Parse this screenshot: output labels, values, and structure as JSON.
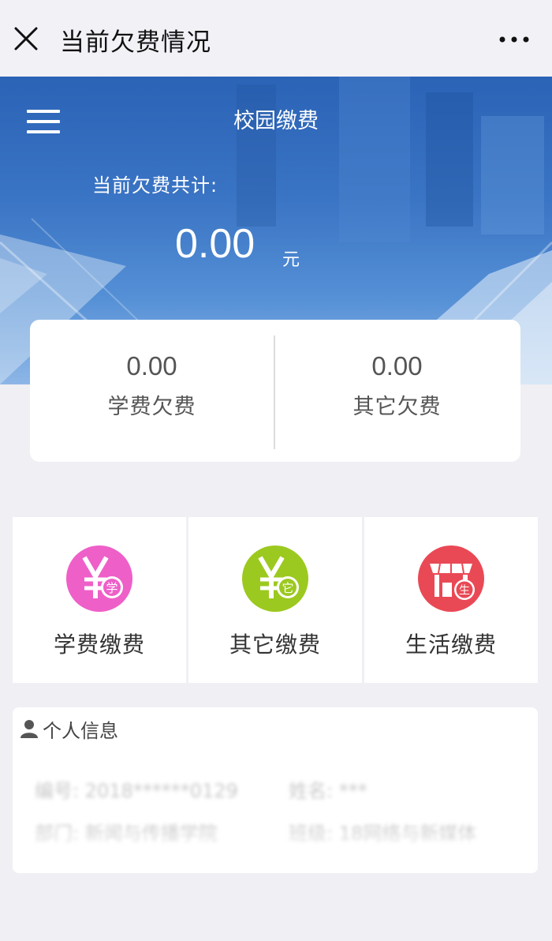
{
  "topbar": {
    "title": "当前欠费情况",
    "close_icon": "close-icon",
    "more_icon": "more-horizontal-icon"
  },
  "hero": {
    "title": "校园缴费",
    "total_label": "当前欠费共计:",
    "total_amount": "0.00",
    "unit": "元",
    "menu_icon": "hamburger-menu-icon"
  },
  "summary": {
    "tuition": {
      "value": "0.00",
      "label": "学费欠费"
    },
    "other": {
      "value": "0.00",
      "label": "其它欠费"
    }
  },
  "payments": [
    {
      "label": "学费缴费",
      "icon": "tuition-yuan-icon",
      "badge": "学",
      "color": "#ee5fc8"
    },
    {
      "label": "其它缴费",
      "icon": "other-yuan-icon",
      "badge": "它",
      "color": "#9cc91f"
    },
    {
      "label": "生活缴费",
      "icon": "living-shop-icon",
      "badge": "生",
      "color": "#e94955"
    }
  ],
  "personal_info": {
    "title": "个人信息",
    "icon": "person-icon",
    "fields": [
      {
        "text": "编号: 2018******0129"
      },
      {
        "text": "姓名: ***"
      },
      {
        "text": "部门: 新闻与传播学院"
      },
      {
        "text": "班级: 18网络与新媒体"
      }
    ]
  }
}
